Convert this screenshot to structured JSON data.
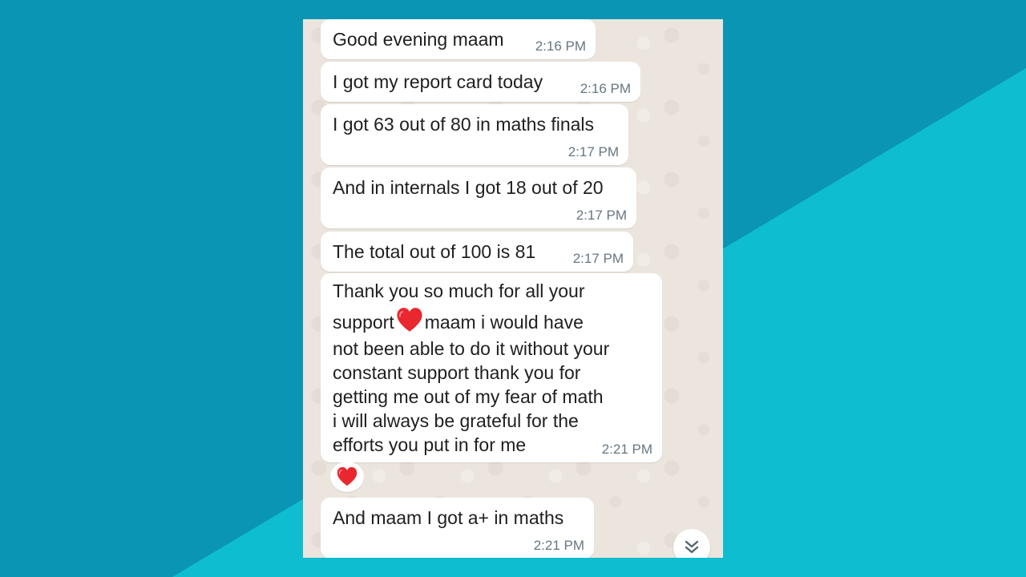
{
  "messages": [
    {
      "text": "Good evening maam",
      "time": "2:16 PM"
    },
    {
      "text": "I got my report card today",
      "time": "2:16 PM"
    },
    {
      "text": "I got 63 out of 80 in maths finals",
      "time": "2:17 PM"
    },
    {
      "text": "And in internals I got 18 out of 20",
      "time": "2:17 PM"
    },
    {
      "text": "The total out of 100 is 81",
      "time": "2:17 PM"
    },
    {
      "lines": [
        "Thank you so much for all your",
        "support",
        "maam i would have",
        "not been able to do it without your",
        "constant support thank you for",
        "getting me out of my fear of math",
        "i will always be grateful for the",
        "efforts you put in for me"
      ],
      "time": "2:21 PM"
    },
    {
      "text": "And maam I got a+ in maths",
      "time": "2:21 PM"
    }
  ],
  "reaction": {
    "icon": "red-heart-icon"
  },
  "icons": {
    "inline_emoji": "red-heart-icon",
    "scroll_button": "double-chevron-down-icon"
  },
  "colors": {
    "background_dark": "#0995b3",
    "background_light": "#0fbdd0",
    "chat_background": "#ece5dd",
    "bubble": "#ffffff",
    "timestamp": "#667781",
    "heart": "#e8272f"
  }
}
